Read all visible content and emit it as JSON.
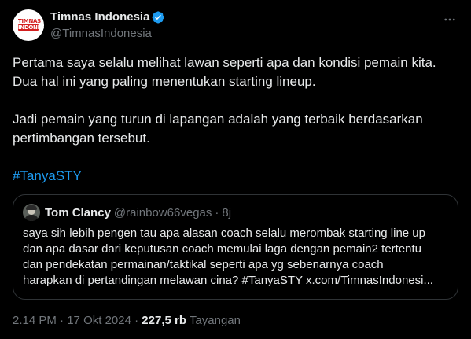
{
  "author": {
    "display_name": "Timnas Indonesia",
    "handle": "@TimnasIndonesia",
    "avatar_logo_text": [
      "TIMNAS",
      "INDONESIA"
    ],
    "verified_icon": "verified-badge-icon",
    "verified_color": "#1d9bf0"
  },
  "more_icon": "more-horizontal-icon",
  "tweet": {
    "paragraph_1": "Pertama saya selalu melihat lawan seperti apa dan kondisi pemain kita. Dua hal ini yang paling menentukan starting lineup.",
    "paragraph_2": "Jadi pemain yang turun di lapangan adalah yang terbaik berdasarkan pertimbangan tersebut.",
    "hashtag": "#TanyaSTY"
  },
  "quoted_tweet": {
    "display_name": "Tom Clancy",
    "handle": "@rainbow66vegas",
    "separator": "·",
    "time": "8j",
    "lines": [
      "saya sih lebih pengen tau apa alasan coach selalu merombak starting line up",
      "dan apa dasar dari keputusan coach memulai laga dengan pemain2 tertentu",
      "dan pendekatan permainan/taktikal seperti apa yg sebenarnya coach",
      "harapkan di pertandingan melawan cina? #TanyaSTY x.com/TimnasIndonesi..."
    ]
  },
  "meta": {
    "time": "2.14 PM",
    "separator": "·",
    "date": "17 Okt 2024",
    "views_count": "227,5 rb",
    "views_label": "Tayangan"
  },
  "colors": {
    "background": "#000000",
    "text_primary": "#e7e9ea",
    "text_secondary": "#71767b",
    "link": "#1d9bf0",
    "border": "#2f3336"
  }
}
